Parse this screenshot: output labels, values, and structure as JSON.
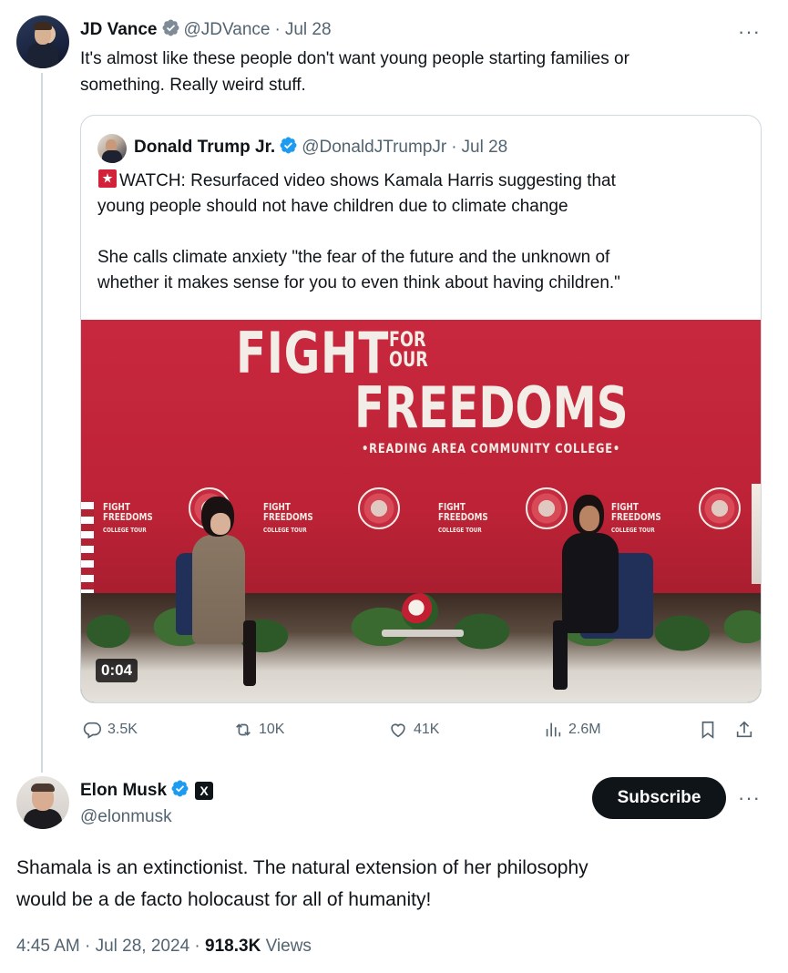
{
  "vance_tweet": {
    "name": "JD Vance",
    "handle": "@JDVance",
    "separator": "·",
    "date": "Jul 28",
    "text_line1": "It's almost like these people don't want young people starting families or",
    "text_line2": "something. Really weird stuff.",
    "more_label": "···"
  },
  "quoted_tweet": {
    "name": "Donald Trump Jr.",
    "handle": "@DonaldJTrumpJr",
    "separator": "·",
    "date": "Jul 28",
    "line1": "WATCH: Resurfaced video shows Kamala Harris suggesting that",
    "line2": "young people should not have children due to climate change",
    "line3": "She calls climate anxiety \"the fear of the future and the unknown of",
    "line4": "whether it makes sense for you to even think about having children.\"",
    "video": {
      "duration": "0:04",
      "banner_fight": "FIGHT",
      "banner_for": "FOR",
      "banner_our": "OUR",
      "banner_freedoms": "FREEDOMS",
      "banner_college": "•READING AREA COMMUNITY COLLEGE•",
      "mini_fight": "FIGHT",
      "mini_freedoms": "FREEDOMS",
      "mini_tour": "COLLEGE TOUR"
    }
  },
  "actions": {
    "replies": "3.5K",
    "reposts": "10K",
    "likes": "41K",
    "views": "2.6M"
  },
  "musk_tweet": {
    "name": "Elon Musk",
    "handle": "@elonmusk",
    "x_badge": "X",
    "subscribe_label": "Subscribe",
    "more_label": "···",
    "text_line1": "Shamala is an extinctionist. The natural extension of her philosophy",
    "text_line2": "would be a de facto holocaust for all of humanity!",
    "time": "4:45 AM",
    "separator": "·",
    "full_date": "Jul 28, 2024",
    "view_count": "918.3K",
    "views_label": "Views"
  },
  "colors": {
    "verified_blue": "#1d9bf0",
    "text_primary": "#0f1419",
    "text_secondary": "#536471",
    "banner_red": "#c8283e"
  }
}
